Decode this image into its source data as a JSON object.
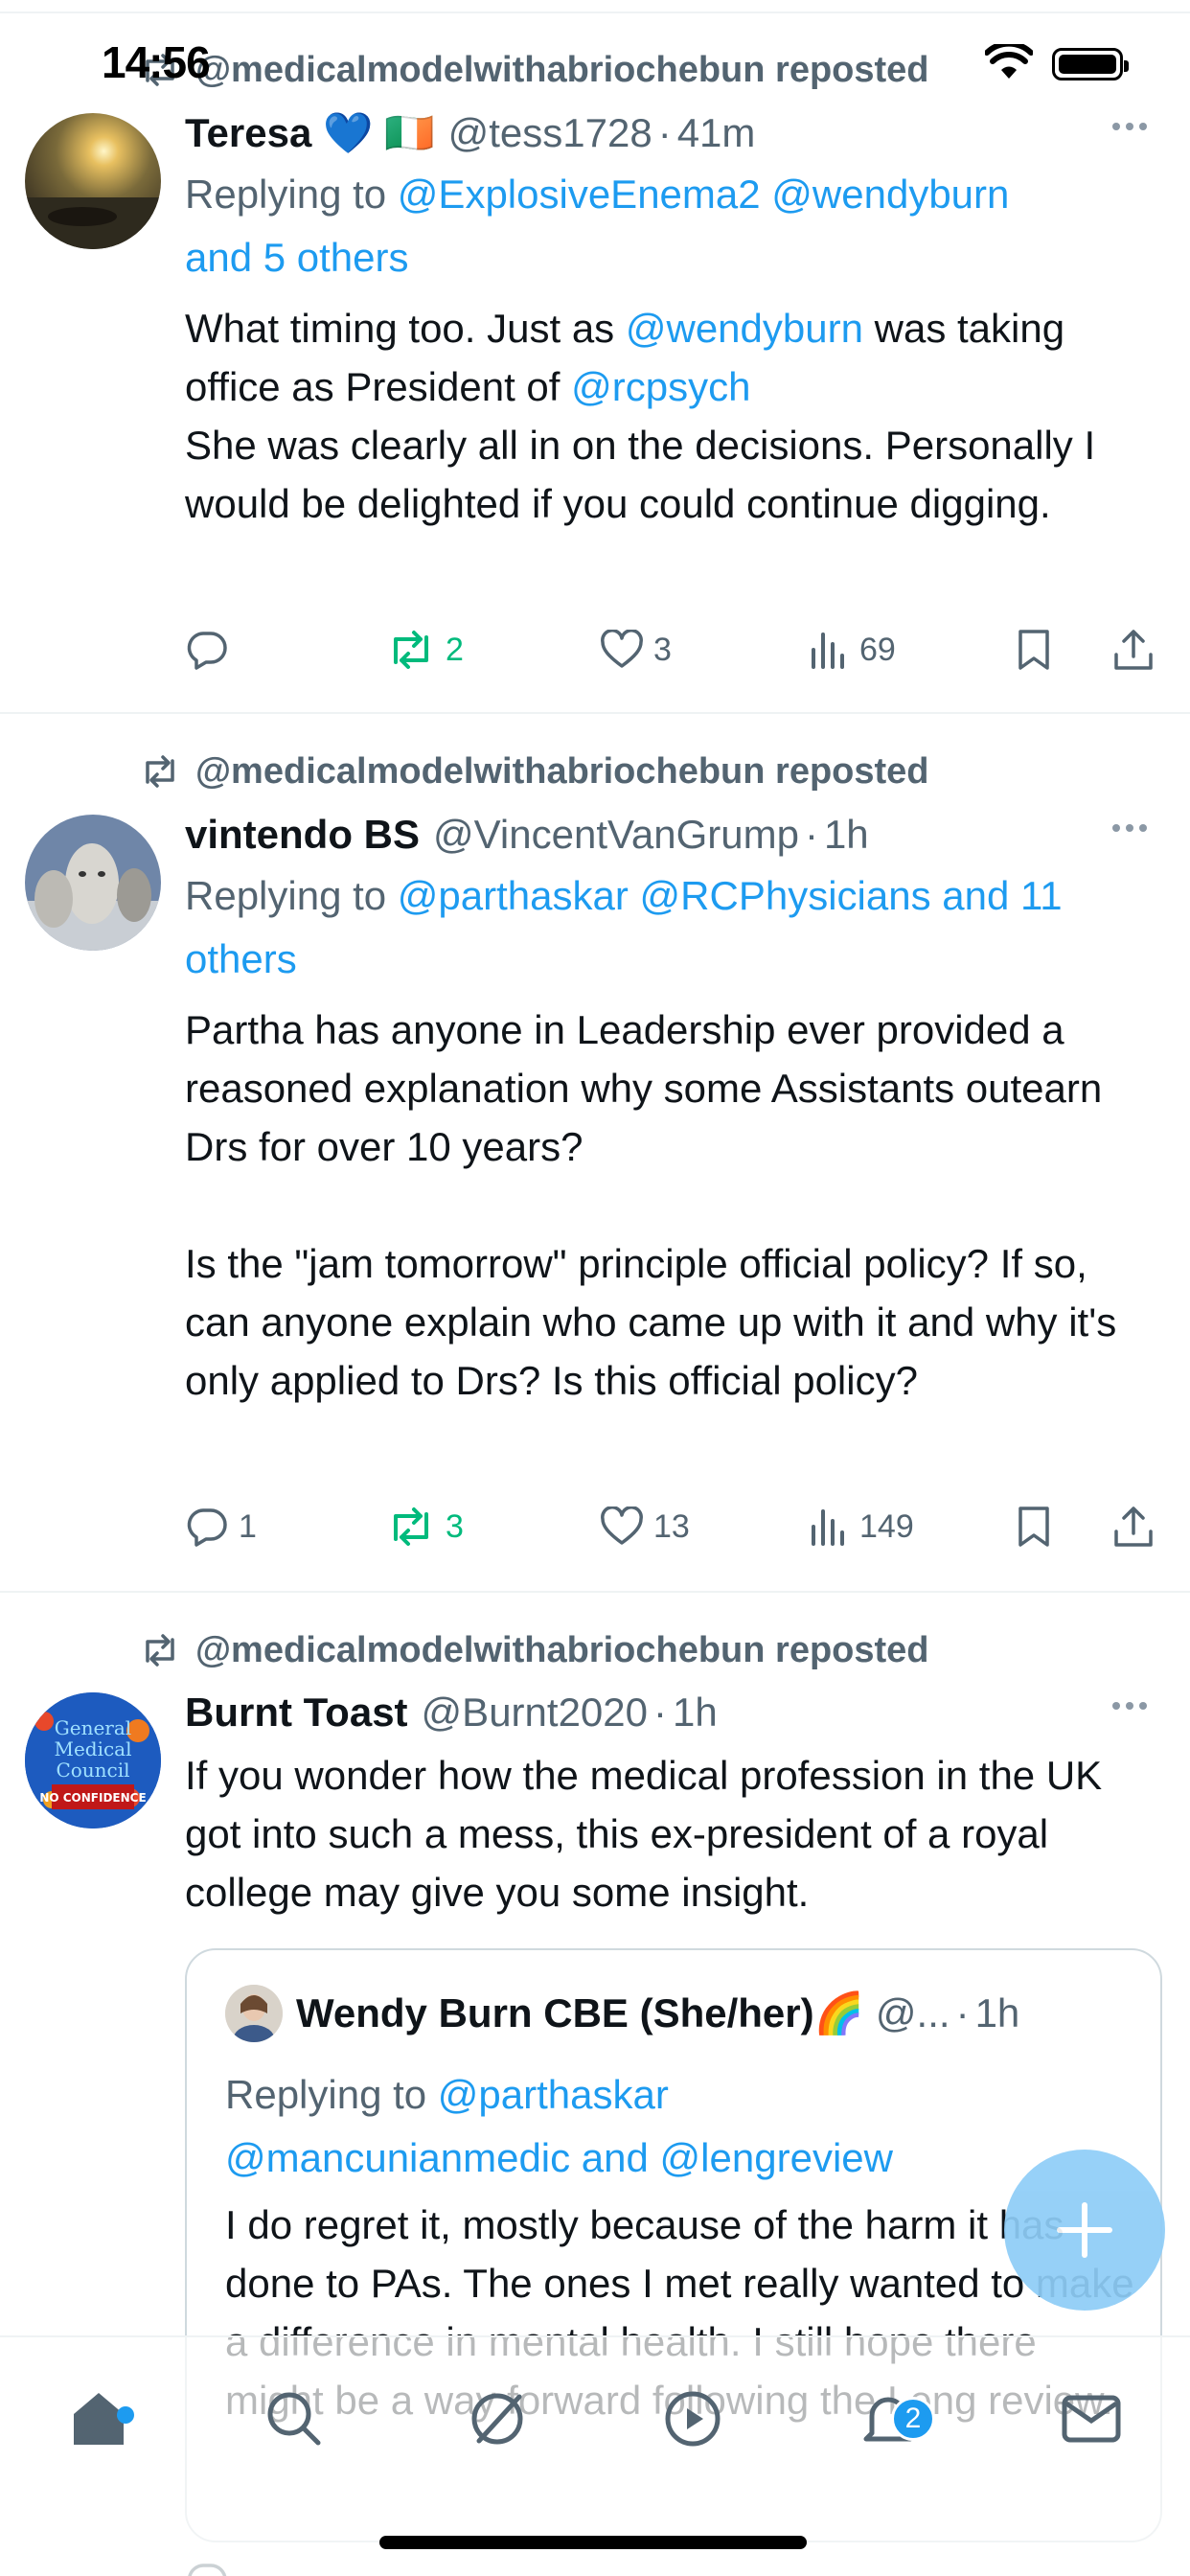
{
  "status_bar": {
    "time": "14:56"
  },
  "tweets": [
    {
      "repost_label": "@medicalmodelwithabriochebun reposted",
      "name": "Teresa",
      "name_emoji": "💙 🇮🇪",
      "handle": "@tess1728",
      "time": "41m",
      "reply_prefix": "Replying to ",
      "reply_links": "@ExplosiveEnema2 @wendyburn",
      "reply_suffix": "and 5 others",
      "body_parts": [
        "What timing too. Just as ",
        "@wendyburn",
        " was taking office as President of ",
        "@rcpsych",
        "\nShe was clearly all in on the decisions. Personally I would be delighted if you could continue digging."
      ],
      "stats": {
        "replies": "",
        "reposts": "2",
        "likes": "3",
        "views": "69"
      }
    },
    {
      "repost_label": "@medicalmodelwithabriochebun reposted",
      "name": "vintendo BS",
      "handle": "@VincentVanGrump",
      "time": "1h",
      "reply_prefix": "Replying to ",
      "reply_links": "@parthaskar @RCPhysicians and 11 others",
      "body": "Partha has anyone in Leadership ever provided a reasoned explanation why some Assistants outearn Drs for over 10 years?\n\nIs the \"jam tomorrow\" principle official policy? If so, can anyone explain who came up with it and why it's only applied to Drs? Is this official policy?",
      "stats": {
        "replies": "1",
        "reposts": "3",
        "likes": "13",
        "views": "149"
      }
    },
    {
      "repost_label": "@medicalmodelwithabriochebun reposted",
      "name": "Burnt Toast",
      "handle": "@Burnt2020",
      "time": "1h",
      "body": "If you wonder how the medical profession in the UK got into such a mess, this ex-president of a royal college may give you some insight.",
      "avatar_text": "General Medical Council NO CONFIDENCE",
      "quote": {
        "name": "Wendy Burn CBE (She/her)🌈",
        "handle": "@...",
        "time": "1h",
        "reply_prefix": "Replying to ",
        "reply_links_1": "@parthaskar",
        "reply_links_2": "@mancunianmedic and @lengreview",
        "body": "I do regret it, mostly because of the harm it has done to PAs. The ones I met really wanted to make a difference in mental health. I still hope there might be a way forward following the Leng review."
      }
    }
  ],
  "nav": {
    "notifications_badge": "2"
  },
  "colors": {
    "accent": "#1d9bf0",
    "repost_green": "#00ba7c",
    "muted": "#536471"
  }
}
